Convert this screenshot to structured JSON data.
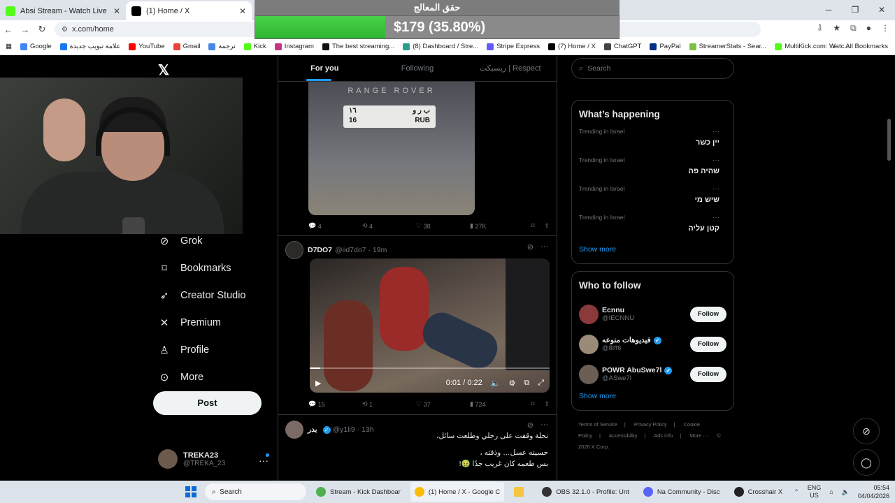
{
  "browser": {
    "tabs": [
      {
        "title": "Absi Stream - Watch Live on Kick",
        "active": false,
        "color": "#53fc18"
      },
      {
        "title": "(1) Home / X",
        "active": true,
        "color": "#000000"
      }
    ],
    "url": "x.com/home",
    "bookmarks": [
      "Google",
      "علامة تبويب جديدة",
      "YouTube",
      "Gmail",
      "ترجمة",
      "Kick",
      "Instagram",
      "The best streaming...",
      "(8) Dashboard / Stre...",
      "Stripe Express",
      "(7) Home / X",
      "ChatGPT",
      "PayPal",
      "StreamerStats - Sear...",
      "MultiKick.com: Watc..."
    ],
    "all_bookmarks": "All Bookmarks"
  },
  "overlay": {
    "title": "حقق المعالج",
    "amount": "$179 (35.80%)",
    "progress_fraction": 0.358,
    "fill_color": "#3fc33f"
  },
  "sidebar": {
    "items": [
      {
        "label": "Grok",
        "icon": "grok-icon"
      },
      {
        "label": "Bookmarks",
        "icon": "bookmark-icon"
      },
      {
        "label": "Creator Studio",
        "icon": "rocket-icon"
      },
      {
        "label": "Premium",
        "icon": "x-logo-icon"
      },
      {
        "label": "Profile",
        "icon": "person-icon"
      },
      {
        "label": "More",
        "icon": "more-circle-icon"
      }
    ],
    "post_label": "Post",
    "account": {
      "name": "TREKA23",
      "handle": "@TREKA_23"
    }
  },
  "feed": {
    "tabs": [
      "For you",
      "Following",
      "ريسبكت | Respect"
    ],
    "post1": {
      "image_brand": "RANGE ROVER",
      "plate_left": [
        "١٦",
        "16"
      ],
      "plate_right": [
        "ب ر و",
        "RUB"
      ],
      "replies": "4",
      "reposts": "4",
      "likes": "38",
      "views": "27K"
    },
    "post2": {
      "user": "D7DO7",
      "handle": "@iid7do7",
      "time": "19m",
      "video_time": "0:01 / 0:22",
      "video_progress_fraction": 0.045,
      "replies": "15",
      "reposts": "1",
      "likes": "37",
      "views": "724"
    },
    "post3": {
      "user": "بدر",
      "handle": "@y1li9",
      "time": "13h",
      "lines": [
        "نحلة وقفت على رجلي وطلعت سائل،",
        "حسيته عسل… وذقته ،",
        "بس طعمه كان غريب جدًا 🤢!"
      ]
    }
  },
  "right": {
    "search_placeholder": "Search",
    "happening_title": "What’s happening",
    "trends": [
      {
        "context": "Trending in Israel",
        "title": "יין כשר"
      },
      {
        "context": "Trending in Israel",
        "title": "שהיה פה"
      },
      {
        "context": "Trending in Israel",
        "title": "שיש מי"
      },
      {
        "context": "Trending in Israel",
        "title": "קטן עליה"
      }
    ],
    "show_more": "Show more",
    "wtf_title": "Who to follow",
    "follow": [
      {
        "name": "Ecnnu",
        "handle": "@IECNNU",
        "verified": false
      },
      {
        "name": "فيديوهات منوعه",
        "handle": "@8iff6",
        "verified": true
      },
      {
        "name": "POWR AbuSwe7l",
        "handle": "@ASwe7l",
        "verified": true
      }
    ],
    "follow_label": "Follow",
    "footer": [
      "Terms of Service",
      "|",
      "Privacy Policy",
      "|",
      "Cookie Policy",
      "|",
      "Accessibility",
      "|",
      "Ads info",
      "|",
      "More ···",
      "© 2026 X Corp."
    ]
  },
  "taskbar": {
    "search": "Search",
    "items": [
      "Stream - Kick Dashboar",
      "(1) Home / X - Google C",
      "OBS 32.1.0 - Profile: Unt",
      "Na Community - Disc",
      "Crosshair X"
    ],
    "lang": "ENG",
    "region": "US",
    "time": "05:54",
    "date": "04/04/2026"
  }
}
